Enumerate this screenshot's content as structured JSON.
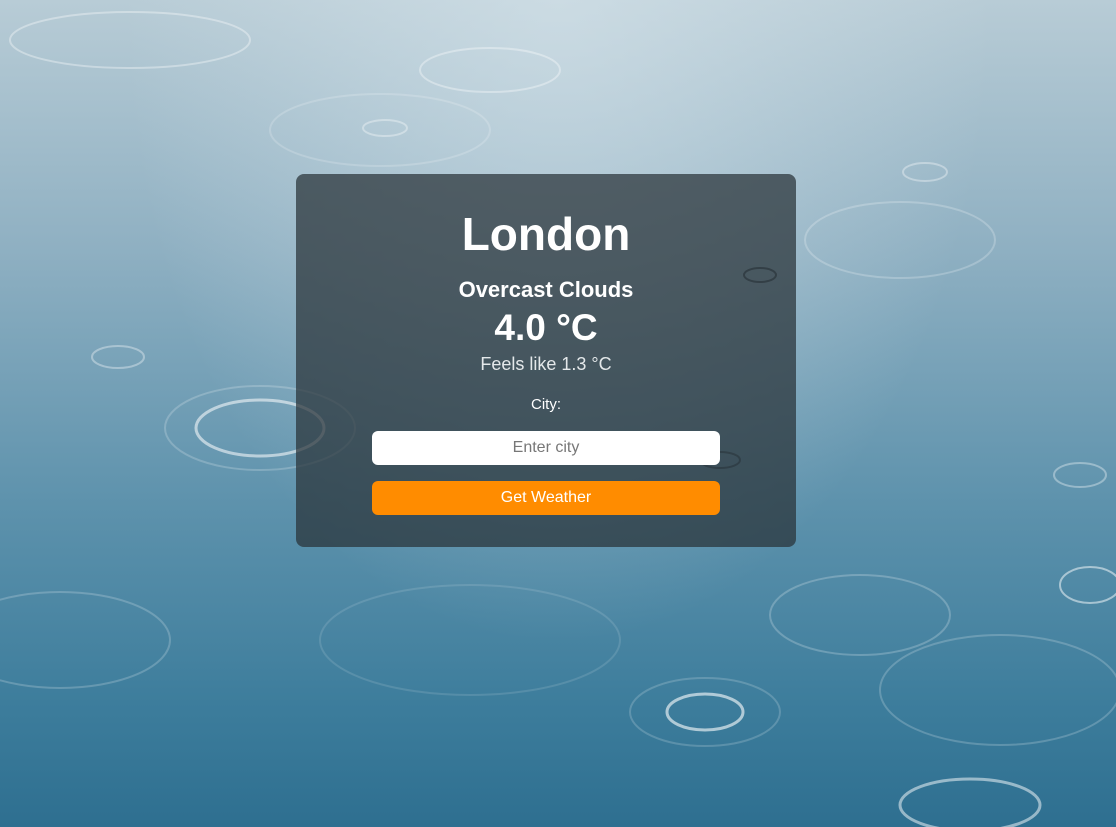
{
  "weather": {
    "city": "London",
    "description": "Overcast Clouds",
    "temperature": "4.0 °C",
    "feels_like": "Feels like 1.3 °C"
  },
  "form": {
    "city_label": "City:",
    "input_value": "",
    "input_placeholder": "Enter city",
    "button_label": "Get Weather"
  },
  "colors": {
    "button": "#ff8c00",
    "card_background": "rgba(40,50,56,0.72)",
    "water": "#3d7d9c"
  }
}
